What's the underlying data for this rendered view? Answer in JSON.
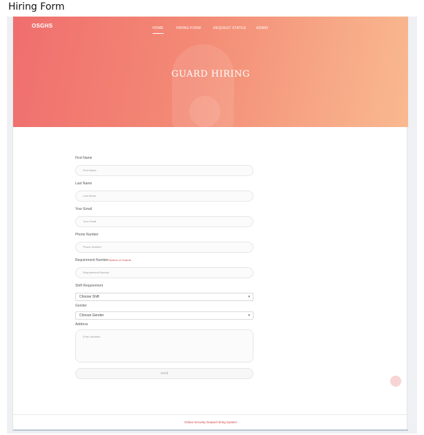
{
  "caption": "Hiring Form",
  "header": {
    "brand": "OSGHS",
    "nav": [
      "HOME",
      "HIRING FORM",
      "REQUEST STATUS",
      "ADMIN"
    ],
    "title": "GUARD HIRING"
  },
  "form": {
    "first_name": {
      "label": "First Name",
      "placeholder": "First Name"
    },
    "last_name": {
      "label": "Last Name",
      "placeholder": "Last Name"
    },
    "email": {
      "label": "Your Email",
      "placeholder": "Your Email"
    },
    "phone": {
      "label": "Phone Number",
      "placeholder": "Phone Number"
    },
    "requirement": {
      "label": "Requirement Number",
      "hint": "Number of Guards",
      "placeholder": "Requirement Number"
    },
    "shift": {
      "label": "Shift Requirement",
      "value": "Choose Shift"
    },
    "gender": {
      "label": "Gender",
      "value": "Choose Gender"
    },
    "address": {
      "label": "Address",
      "placeholder": "Enter Address"
    },
    "send_label": "send"
  },
  "footer": {
    "text": "Online Security Guaard Hiring System"
  },
  "colors": {
    "accent": "#f06e6e",
    "hero_end": "#f9b98f",
    "link": "#d43c3c"
  }
}
